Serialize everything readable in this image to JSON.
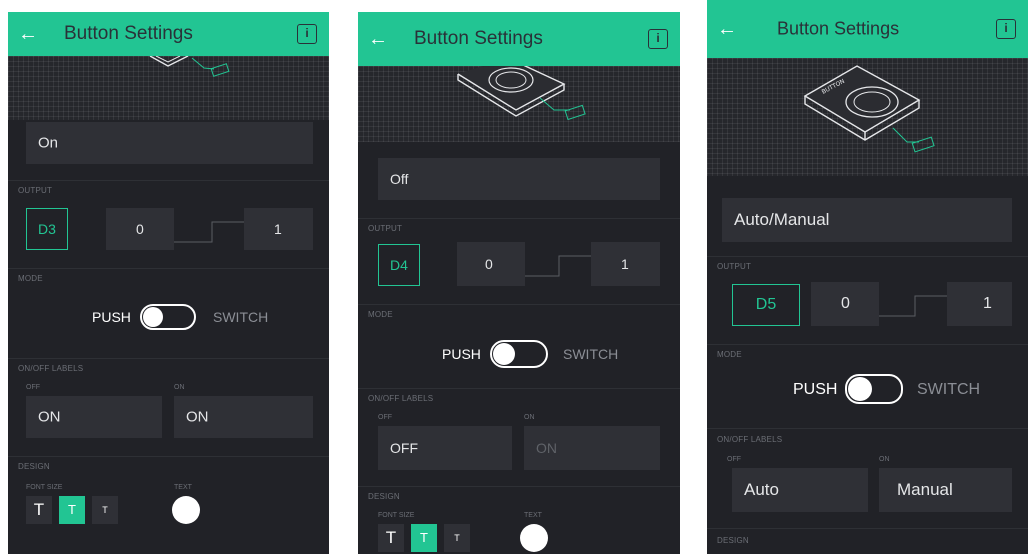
{
  "screens": [
    {
      "header": {
        "title": "Button Settings",
        "back_icon": "arrow-left-icon",
        "info_icon": "info-icon"
      },
      "name_field": {
        "value": "On"
      },
      "output": {
        "section_label": "OUTPUT",
        "pin": "D3",
        "low": "0",
        "high": "1"
      },
      "mode": {
        "section_label": "MODE",
        "push_label": "PUSH",
        "switch_label": "SWITCH",
        "selected": "PUSH"
      },
      "labels": {
        "section_label": "ON/OFF LABELS",
        "off_caption": "OFF",
        "on_caption": "ON",
        "off_value": "ON",
        "on_value": "ON"
      },
      "design": {
        "section_label": "DESIGN",
        "font_size_label": "FONT SIZE",
        "text_label": "TEXT",
        "sizes": [
          "T",
          "T",
          "T"
        ],
        "text_color": "#ffffff"
      }
    },
    {
      "header": {
        "title": "Button Settings",
        "back_icon": "arrow-left-icon",
        "info_icon": "info-icon"
      },
      "name_field": {
        "value": "Off"
      },
      "output": {
        "section_label": "OUTPUT",
        "pin": "D4",
        "low": "0",
        "high": "1"
      },
      "mode": {
        "section_label": "MODE",
        "push_label": "PUSH",
        "switch_label": "SWITCH",
        "selected": "PUSH"
      },
      "labels": {
        "section_label": "ON/OFF LABELS",
        "off_caption": "OFF",
        "on_caption": "ON",
        "off_value": "OFF",
        "on_value": "ON"
      },
      "design": {
        "section_label": "DESIGN",
        "font_size_label": "FONT SIZE",
        "text_label": "TEXT",
        "sizes": [
          "T",
          "T",
          "T"
        ],
        "text_color": "#ffffff"
      }
    },
    {
      "header": {
        "title": "Button Settings",
        "back_icon": "arrow-left-icon",
        "info_icon": "info-icon"
      },
      "illustration_label": "BUTTON",
      "name_field": {
        "value": "Auto/Manual"
      },
      "output": {
        "section_label": "OUTPUT",
        "pin": "D5",
        "low": "0",
        "high": "1"
      },
      "mode": {
        "section_label": "MODE",
        "push_label": "PUSH",
        "switch_label": "SWITCH",
        "selected": "PUSH"
      },
      "labels": {
        "section_label": "ON/OFF LABELS",
        "off_caption": "OFF",
        "on_caption": "ON",
        "off_value": "Auto",
        "on_value": "Manual"
      },
      "design": {
        "section_label": "DESIGN"
      }
    }
  ],
  "colors": {
    "accent": "#22c593",
    "panel": "#212227",
    "field": "#2f3036",
    "muted_text": "#6b6e75"
  }
}
